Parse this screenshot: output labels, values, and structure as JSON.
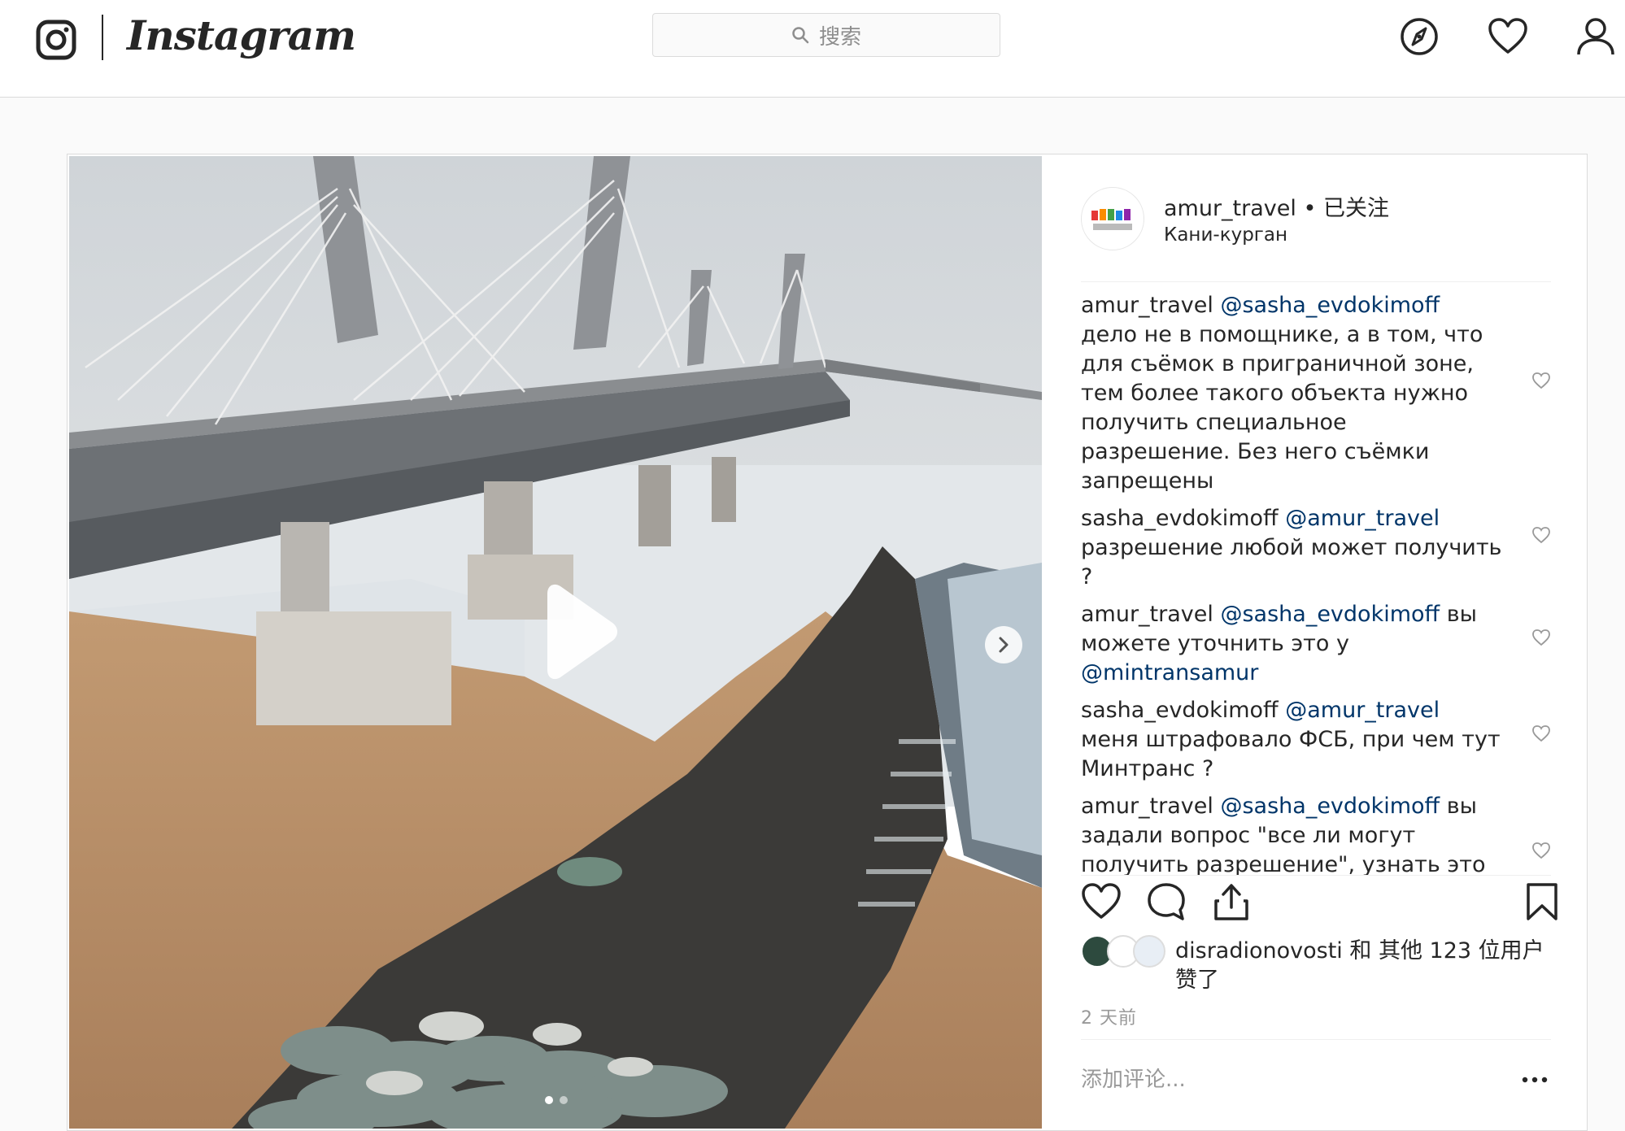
{
  "nav": {
    "brand": "Instagram",
    "search_placeholder": "搜索",
    "icons": [
      "explore-icon",
      "heart-icon",
      "profile-icon"
    ]
  },
  "post": {
    "username": "amur_travel",
    "follow_separator": "•",
    "follow_status": "已关注",
    "location": "Кани-курган",
    "media": {
      "type": "video",
      "carousel_count": 2,
      "active_index": 0
    },
    "comments": [
      {
        "user": "amur_travel",
        "mention": "@sasha_evdokimoff",
        "text": " дело не в помощнике, а в том, что для съёмок в приграничной зоне, тем более такого объекта нужно получить специальное разрешение. Без него съёмки запрещены"
      },
      {
        "user": "sasha_evdokimoff",
        "mention": "@amur_travel",
        "text": " разрешение любой может получить ?"
      },
      {
        "user": "amur_travel",
        "mention": "@sasha_evdokimoff",
        "text": " вы можете уточнить это у ",
        "mention2": "@mintransamur"
      },
      {
        "user": "sasha_evdokimoff",
        "mention": "@amur_travel",
        "text": " меня штрафовало ФСБ, при чем тут Минтранс ?"
      },
      {
        "user": "amur_travel",
        "mention": "@sasha_evdokimoff",
        "text": " вы задали вопрос \"все ли могут получить разрешение\", узнать это"
      }
    ],
    "likes": {
      "first_user": "disradionovosti",
      "rest": " 和 其他 123 位用户赞了",
      "count": 123
    },
    "timestamp": "2 天前",
    "comment_placeholder": "添加评论...",
    "more_label": "•••",
    "colors": {
      "mention": "#003569",
      "border": "#dbdbdb",
      "muted": "#999999"
    }
  }
}
